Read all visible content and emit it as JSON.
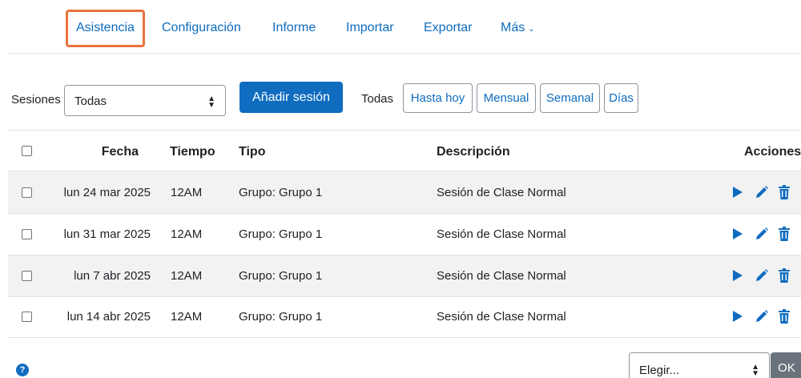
{
  "nav": {
    "items": [
      {
        "label": "Asistencia",
        "active": true
      },
      {
        "label": "Configuración"
      },
      {
        "label": "Informe"
      },
      {
        "label": "Importar"
      },
      {
        "label": "Exportar"
      },
      {
        "label": "Más"
      }
    ]
  },
  "controls": {
    "sessions_label": "Sesiones",
    "sessions_select": "Todas",
    "add_session": "Añadir sesión",
    "all_label": "Todas",
    "filters": [
      "Hasta hoy",
      "Mensual",
      "Semanal",
      "Días"
    ]
  },
  "table": {
    "headers": {
      "date": "Fecha",
      "time": "Tiempo",
      "type": "Tipo",
      "description": "Descripción",
      "actions": "Acciones"
    },
    "rows": [
      {
        "date": "lun 24 mar 2025",
        "time": "12AM",
        "type": "Grupo: Grupo 1",
        "description": "Sesión de Clase Normal"
      },
      {
        "date": "lun 31 mar 2025",
        "time": "12AM",
        "type": "Grupo: Grupo 1",
        "description": "Sesión de Clase Normal"
      },
      {
        "date": "lun 7 abr 2025",
        "time": "12AM",
        "type": "Grupo: Grupo 1",
        "description": "Sesión de Clase Normal"
      },
      {
        "date": "lun 14 abr 2025",
        "time": "12AM",
        "type": "Grupo: Grupo 1",
        "description": "Sesión de Clase Normal"
      }
    ]
  },
  "footer": {
    "help": "?",
    "choose_select": "Elegir...",
    "ok": "OK"
  },
  "colors": {
    "accent": "#0f6cbf",
    "active_outline": "#e8733b"
  }
}
